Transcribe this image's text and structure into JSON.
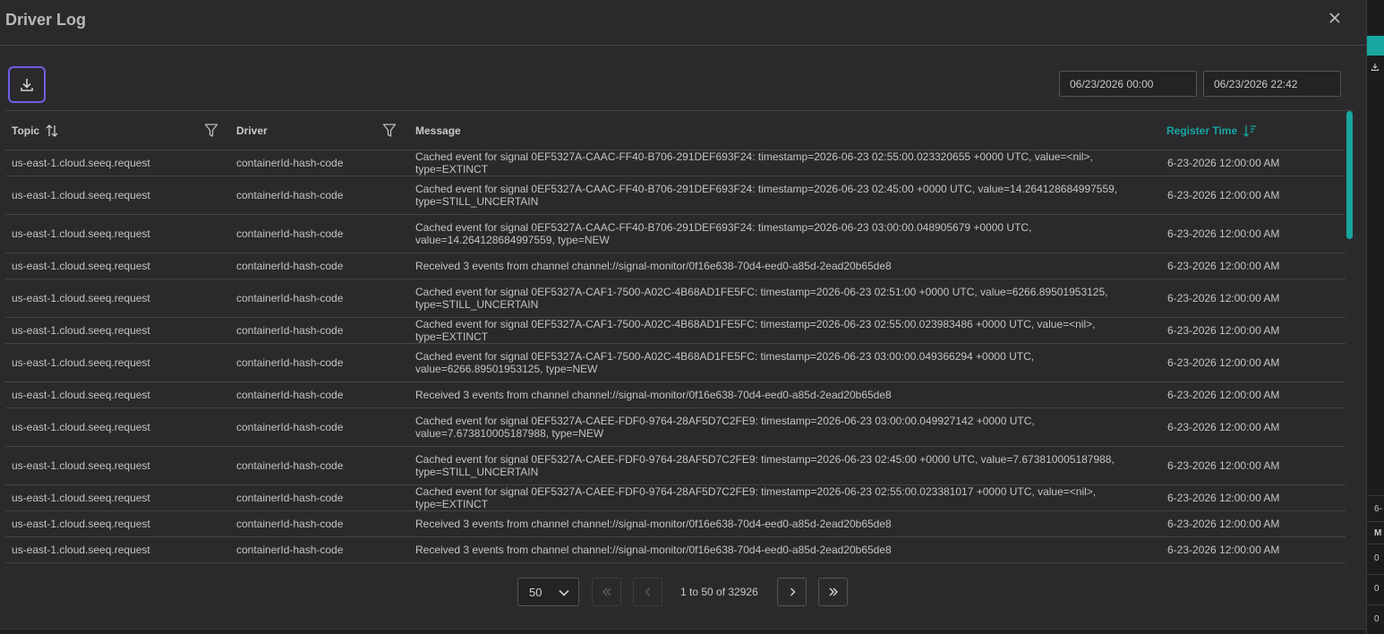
{
  "dialog": {
    "title": "Driver Log"
  },
  "filters": {
    "start_date": "06/23/2026 00:00",
    "end_date": "06/23/2026 22:42"
  },
  "grid": {
    "columns": {
      "topic": "Topic",
      "driver": "Driver",
      "message": "Message",
      "register_time": "Register Time"
    },
    "rows": [
      {
        "topic": "us-east-1.cloud.seeq.request",
        "driver": "containerId-hash-code",
        "message": "Cached event for signal 0EF5327A-CAAC-FF40-B706-291DEF693F24: timestamp=2026-06-23 02:55:00.023320655 +0000 UTC, value=<nil>, type=EXTINCT",
        "time": "6-23-2026 12:00:00 AM",
        "lines": 1
      },
      {
        "topic": "us-east-1.cloud.seeq.request",
        "driver": "containerId-hash-code",
        "message": "Cached event for signal 0EF5327A-CAAC-FF40-B706-291DEF693F24: timestamp=2026-06-23 02:45:00 +0000 UTC, value=14.264128684997559, type=STILL_UNCERTAIN",
        "time": "6-23-2026 12:00:00 AM",
        "lines": 2
      },
      {
        "topic": "us-east-1.cloud.seeq.request",
        "driver": "containerId-hash-code",
        "message": "Cached event for signal 0EF5327A-CAAC-FF40-B706-291DEF693F24: timestamp=2026-06-23 03:00:00.048905679 +0000 UTC, value=14.264128684997559, type=NEW",
        "time": "6-23-2026 12:00:00 AM",
        "lines": 2
      },
      {
        "topic": "us-east-1.cloud.seeq.request",
        "driver": "containerId-hash-code",
        "message": "Received 3 events from channel channel://signal-monitor/0f16e638-70d4-eed0-a85d-2ead20b65de8",
        "time": "6-23-2026 12:00:00 AM",
        "lines": 1
      },
      {
        "topic": "us-east-1.cloud.seeq.request",
        "driver": "containerId-hash-code",
        "message": "Cached event for signal 0EF5327A-CAF1-7500-A02C-4B68AD1FE5FC: timestamp=2026-06-23 02:51:00 +0000 UTC, value=6266.89501953125, type=STILL_UNCERTAIN",
        "time": "6-23-2026 12:00:00 AM",
        "lines": 2
      },
      {
        "topic": "us-east-1.cloud.seeq.request",
        "driver": "containerId-hash-code",
        "message": "Cached event for signal 0EF5327A-CAF1-7500-A02C-4B68AD1FE5FC: timestamp=2026-06-23 02:55:00.023983486 +0000 UTC, value=<nil>, type=EXTINCT",
        "time": "6-23-2026 12:00:00 AM",
        "lines": 1
      },
      {
        "topic": "us-east-1.cloud.seeq.request",
        "driver": "containerId-hash-code",
        "message": "Cached event for signal 0EF5327A-CAF1-7500-A02C-4B68AD1FE5FC: timestamp=2026-06-23 03:00:00.049366294 +0000 UTC, value=6266.89501953125, type=NEW",
        "time": "6-23-2026 12:00:00 AM",
        "lines": 2
      },
      {
        "topic": "us-east-1.cloud.seeq.request",
        "driver": "containerId-hash-code",
        "message": "Received 3 events from channel channel://signal-monitor/0f16e638-70d4-eed0-a85d-2ead20b65de8",
        "time": "6-23-2026 12:00:00 AM",
        "lines": 1
      },
      {
        "topic": "us-east-1.cloud.seeq.request",
        "driver": "containerId-hash-code",
        "message": "Cached event for signal 0EF5327A-CAEE-FDF0-9764-28AF5D7C2FE9: timestamp=2026-06-23 03:00:00.049927142 +0000 UTC, value=7.673810005187988, type=NEW",
        "time": "6-23-2026 12:00:00 AM",
        "lines": 2
      },
      {
        "topic": "us-east-1.cloud.seeq.request",
        "driver": "containerId-hash-code",
        "message": "Cached event for signal 0EF5327A-CAEE-FDF0-9764-28AF5D7C2FE9: timestamp=2026-06-23 02:45:00 +0000 UTC, value=7.673810005187988, type=STILL_UNCERTAIN",
        "time": "6-23-2026 12:00:00 AM",
        "lines": 2
      },
      {
        "topic": "us-east-1.cloud.seeq.request",
        "driver": "containerId-hash-code",
        "message": "Cached event for signal 0EF5327A-CAEE-FDF0-9764-28AF5D7C2FE9: timestamp=2026-06-23 02:55:00.023381017 +0000 UTC, value=<nil>, type=EXTINCT",
        "time": "6-23-2026 12:00:00 AM",
        "lines": 1
      },
      {
        "topic": "us-east-1.cloud.seeq.request",
        "driver": "containerId-hash-code",
        "message": "Received 3 events from channel channel://signal-monitor/0f16e638-70d4-eed0-a85d-2ead20b65de8",
        "time": "6-23-2026 12:00:00 AM",
        "lines": 1
      },
      {
        "topic": "us-east-1.cloud.seeq.request",
        "driver": "containerId-hash-code",
        "message": "Received 3 events from channel channel://signal-monitor/0f16e638-70d4-eed0-a85d-2ead20b65de8",
        "time": "6-23-2026 12:00:00 AM",
        "lines": 1
      }
    ]
  },
  "pagination": {
    "page_size": "50",
    "info": "1 to 50 of 32926"
  },
  "background_panel": {
    "date_fragment": "6-",
    "col_header": "M",
    "values": [
      "0",
      "0",
      "0"
    ]
  },
  "colors": {
    "accent": "#18a6a0",
    "focus_outline": "#6d5fe6",
    "background": "#2a2a2c"
  },
  "icons": {
    "close": "close-icon",
    "download": "download-icon",
    "sort": "sort-icon",
    "filter": "filter-icon",
    "sort_desc": "sort-descending-icon"
  }
}
